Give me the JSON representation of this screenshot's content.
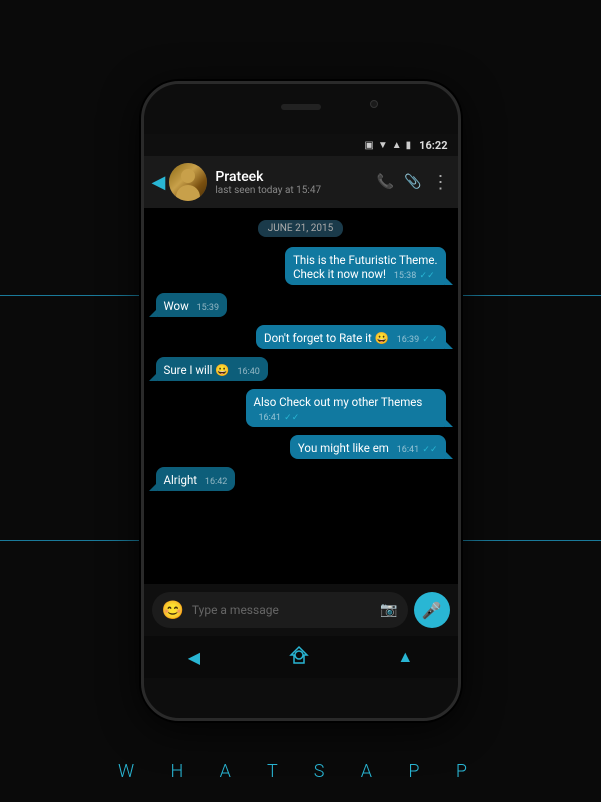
{
  "phone": {
    "status_bar": {
      "time": "16:22",
      "icons": [
        "vibrate",
        "signal",
        "network",
        "battery"
      ]
    },
    "header": {
      "back_label": "◀",
      "contact_name": "Prateek",
      "contact_status": "last seen today at 15:47",
      "action_call": "📞",
      "action_attach": "📎",
      "action_more": "⋮"
    },
    "date_label": "JUNE 21, 2015",
    "messages": [
      {
        "id": 1,
        "type": "sent",
        "text": "This is the Futuristic Theme.\nCheck it now now!",
        "time": "15:38",
        "status": "read"
      },
      {
        "id": 2,
        "type": "received",
        "text": "Wow",
        "time": "15:39"
      },
      {
        "id": 3,
        "type": "sent",
        "text": "Don't forget to Rate it 😀",
        "time": "16:39",
        "status": "read"
      },
      {
        "id": 4,
        "type": "received",
        "text": "Sure I will 😀",
        "time": "16:40"
      },
      {
        "id": 5,
        "type": "sent",
        "text": "Also Check out my other Themes",
        "time": "16:41",
        "status": "read"
      },
      {
        "id": 6,
        "type": "sent",
        "text": "You might like em",
        "time": "16:41",
        "status": "read"
      },
      {
        "id": 7,
        "type": "received",
        "text": "Alright",
        "time": "16:42"
      }
    ],
    "input": {
      "placeholder": "Type a message",
      "emoji_icon": "😊",
      "mic_icon": "🎤"
    },
    "nav": {
      "back": "◀",
      "home": "⬡",
      "recents": "▲"
    }
  },
  "footer": {
    "app_title": "W H A T S A P P"
  }
}
